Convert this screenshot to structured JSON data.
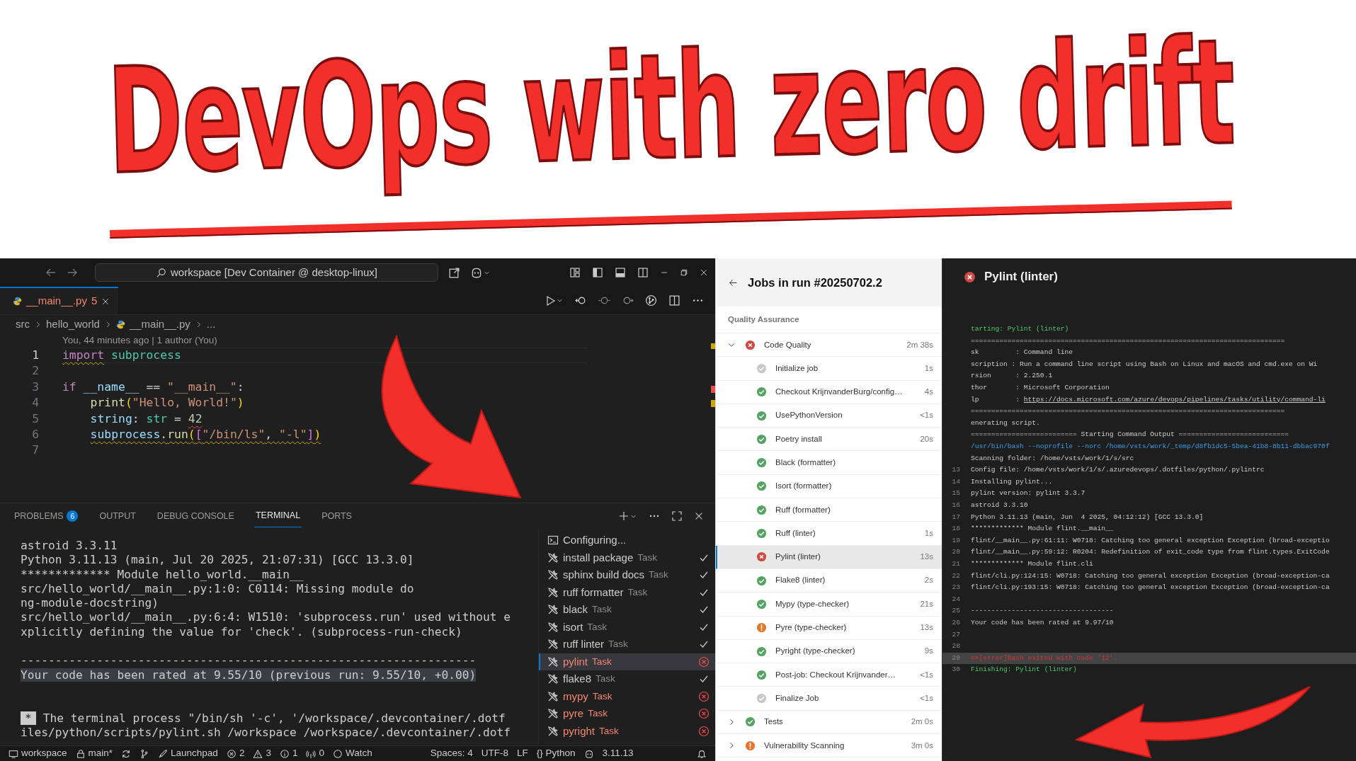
{
  "banner": {
    "title": "DevOps with zero drift"
  },
  "editor_window": {
    "search": "workspace [Dev Container @ desktop-linux]",
    "tabs": [
      {
        "label": "__main__.py",
        "badge": "5",
        "selected": true
      }
    ],
    "breadcrumb": [
      "src",
      "hello_world",
      "__main__.py",
      "..."
    ],
    "blame": "You, 44 minutes ago | 1 author (You)",
    "code_lines": [
      {
        "number": "1",
        "current": true,
        "tokens": [
          {
            "text": "import",
            "kind": "keyword",
            "warning": true
          },
          {
            "text": " subprocess",
            "kind": "module"
          }
        ]
      },
      {
        "number": "2",
        "current": false
      },
      {
        "number": "3",
        "current": false,
        "tokens": [
          {
            "text": "if ",
            "kind": "keyword"
          },
          {
            "text": "__name__",
            "kind": "var"
          },
          {
            "text": " == ",
            "kind": "plain"
          },
          {
            "text": "\"__main__\"",
            "kind": "string"
          },
          {
            "text": ":",
            "kind": "plain"
          }
        ]
      },
      {
        "number": "4",
        "current": false,
        "indented": true,
        "tokens": [
          {
            "text": "print",
            "kind": "func"
          },
          {
            "text": "(",
            "kind": "bracket1"
          },
          {
            "text": "\"Hello, World!\"",
            "kind": "string"
          },
          {
            "text": ")",
            "kind": "bracket1"
          }
        ]
      },
      {
        "number": "5",
        "current": false,
        "indented": true,
        "tokens": [
          {
            "text": "string",
            "kind": "var"
          },
          {
            "text": ": ",
            "kind": "plain"
          },
          {
            "text": "str",
            "kind": "type"
          },
          {
            "text": " = ",
            "kind": "plain"
          },
          {
            "text": "42",
            "kind": "number",
            "error": true
          }
        ]
      },
      {
        "number": "6",
        "current": false,
        "indented": true,
        "tokens": [
          {
            "text": "subprocess",
            "kind": "var",
            "warning": true
          },
          {
            "text": ".",
            "kind": "plain",
            "warning": true
          },
          {
            "text": "run",
            "kind": "func",
            "warning": true
          },
          {
            "text": "(",
            "kind": "bracket1",
            "warning": true
          },
          {
            "text": "[",
            "kind": "bracket2",
            "warning": true
          },
          {
            "text": "\"/bin/ls\"",
            "kind": "string",
            "warning": true
          },
          {
            "text": ", ",
            "kind": "plain",
            "warning": true
          },
          {
            "text": "\"-l\"",
            "kind": "string",
            "warning": true
          },
          {
            "text": "]",
            "kind": "bracket2",
            "warning": true
          },
          {
            "text": ")",
            "kind": "bracket1",
            "warning": true
          }
        ]
      },
      {
        "number": "7",
        "current": false
      }
    ],
    "panel_tabs": [
      {
        "label": "PROBLEMS",
        "count": "6",
        "selected": false
      },
      {
        "label": "OUTPUT",
        "selected": false
      },
      {
        "label": "DEBUG CONSOLE",
        "selected": false
      },
      {
        "label": "TERMINAL",
        "selected": true
      },
      {
        "label": "PORTS",
        "selected": false
      }
    ],
    "terminal_lines": [
      {
        "kind": "text",
        "text": "astroid 3.3.11"
      },
      {
        "kind": "text",
        "text": "Python 3.11.13 (main, Jul 20 2025, 21:07:31) [GCC 13.3.0]"
      },
      {
        "kind": "text",
        "text": "************* Module hello_world.__main__"
      },
      {
        "kind": "text",
        "text": "src/hello_world/__main__.py:1:0: C0114: Missing module do"
      },
      {
        "kind": "text",
        "text": "ng-module-docstring)"
      },
      {
        "kind": "text",
        "text": "src/hello_world/__main__.py:6:4: W1510: 'subprocess.run' used without e"
      },
      {
        "kind": "text",
        "text": "xplicitly defining the value for 'check'. (subprocess-run-check)"
      },
      {
        "kind": "blank"
      },
      {
        "kind": "text",
        "text": "------------------------------------------------------------------"
      },
      {
        "kind": "highlight",
        "text": "Your code has been rated at 9.55/10 (previous run: 9.55/10, +0.00)"
      },
      {
        "kind": "blank"
      },
      {
        "kind": "blank"
      },
      {
        "kind": "badge",
        "badge": "*",
        "text": "The terminal process \"/bin/sh '-c', '/workspace/.devcontainer/.dotf"
      },
      {
        "kind": "text",
        "text": "iles/python/scripts/pylint.sh /workspace /workspace/.devcontainer/.dotf"
      }
    ],
    "tasks": [
      {
        "kind": "terminal",
        "label": "Configuring...",
        "passed": false,
        "failed": false,
        "selected": false
      },
      {
        "kind": "task",
        "label": "install package",
        "suffix": "Task",
        "passed": true,
        "failed": false,
        "selected": false
      },
      {
        "kind": "task",
        "label": "sphinx build docs",
        "suffix": "Task",
        "passed": true,
        "failed": false,
        "selected": false
      },
      {
        "kind": "task",
        "label": "ruff formatter",
        "suffix": "Task",
        "passed": true,
        "failed": false,
        "selected": false
      },
      {
        "kind": "task",
        "label": "black",
        "suffix": "Task",
        "passed": true,
        "failed": false,
        "selected": false
      },
      {
        "kind": "task",
        "label": "isort",
        "suffix": "Task",
        "passed": true,
        "failed": false,
        "selected": false
      },
      {
        "kind": "task",
        "label": "ruff linter",
        "suffix": "Task",
        "passed": true,
        "failed": false,
        "selected": false
      },
      {
        "kind": "task",
        "label": "pylint",
        "suffix": "Task",
        "passed": false,
        "failed": true,
        "selected": true
      },
      {
        "kind": "task",
        "label": "flake8",
        "suffix": "Task",
        "passed": true,
        "failed": false,
        "selected": false
      },
      {
        "kind": "task",
        "label": "mypy",
        "suffix": "Task",
        "passed": false,
        "failed": true,
        "selected": false
      },
      {
        "kind": "task",
        "label": "pyre",
        "suffix": "Task",
        "passed": false,
        "failed": true,
        "selected": false
      },
      {
        "kind": "task",
        "label": "pyright",
        "suffix": "Task",
        "passed": false,
        "failed": true,
        "selected": false
      }
    ],
    "status_bar": [
      {
        "kind": "remote",
        "text": "workspace"
      },
      {
        "kind": "branch",
        "text": "main*"
      },
      {
        "kind": "sync"
      },
      {
        "kind": "graph"
      },
      {
        "kind": "launchpad",
        "text": "Launchpad"
      },
      {
        "kind": "errors",
        "text": "2"
      },
      {
        "kind": "warnings",
        "text": "3"
      },
      {
        "kind": "infos",
        "text": "1"
      },
      {
        "kind": "ports",
        "text": "0"
      },
      {
        "kind": "watch",
        "text": "Watch"
      },
      {
        "kind": "plain",
        "text": "Spaces: 4"
      },
      {
        "kind": "plain",
        "text": "UTF-8"
      },
      {
        "kind": "plain",
        "text": "LF"
      },
      {
        "kind": "plain",
        "text": "{} Python"
      },
      {
        "kind": "copilot"
      },
      {
        "kind": "plain",
        "text": "3.11.13"
      },
      {
        "kind": "bell"
      }
    ]
  },
  "jobs_panel": {
    "title": "Jobs in run #20250702.2",
    "section": "Quality Assurance",
    "jobs": [
      {
        "name": "Code Quality",
        "kind": "failed",
        "duration": "2m 38s",
        "expanded": true,
        "steps": [
          {
            "name": "Initialize job",
            "kind": "skipped",
            "duration": "1s",
            "selected": false
          },
          {
            "name": "Checkout KrijnvanderBurg/config…",
            "kind": "succeeded",
            "duration": "4s",
            "selected": false
          },
          {
            "name": "UsePythonVersion",
            "kind": "succeeded",
            "duration": "<1s",
            "selected": false
          },
          {
            "name": "Poetry install",
            "kind": "succeeded",
            "duration": "20s",
            "selected": false
          },
          {
            "name": "Black (formatter)",
            "kind": "succeeded",
            "selected": false
          },
          {
            "name": "Isort (formatter)",
            "kind": "succeeded",
            "selected": false
          },
          {
            "name": "Ruff (formatter)",
            "kind": "succeeded",
            "selected": false
          },
          {
            "name": "Ruff (linter)",
            "kind": "succeeded",
            "duration": "1s",
            "selected": false
          },
          {
            "name": "Pylint (linter)",
            "kind": "failed",
            "duration": "13s",
            "selected": true
          },
          {
            "name": "Flake8 (linter)",
            "kind": "succeeded",
            "duration": "2s",
            "selected": false
          },
          {
            "name": "Mypy (type-checker)",
            "kind": "succeeded",
            "duration": "21s",
            "selected": false
          },
          {
            "name": "Pyre (type-checker)",
            "kind": "warning",
            "duration": "13s",
            "selected": false
          },
          {
            "name": "Pyright (type-checker)",
            "kind": "succeeded",
            "duration": "9s",
            "selected": false
          },
          {
            "name": "Post-job: Checkout Krijnvander…",
            "kind": "succeeded",
            "duration": "<1s",
            "selected": false
          },
          {
            "name": "Finalize Job",
            "kind": "skipped",
            "duration": "<1s",
            "selected": false
          }
        ]
      },
      {
        "name": "Tests",
        "kind": "succeeded",
        "duration": "2m 0s",
        "expanded": false
      },
      {
        "name": "Vulnerability Scanning",
        "kind": "warning",
        "duration": "3m 0s",
        "expanded": false
      }
    ]
  },
  "log_panel": {
    "title": "Pylint (linter)",
    "failed": true,
    "lines": [
      {
        "kind": "green",
        "text": "tarting: Pylint (linter)"
      },
      {
        "kind": "normal",
        "text": "============================================================================="
      },
      {
        "kind": "normal",
        "text": "sk         : Command line"
      },
      {
        "kind": "normal",
        "text": "scription : Run a command line script using Bash on Linux and macOS and cmd.exe on Wi"
      },
      {
        "kind": "normal",
        "text": "rsion      : 2.250.1"
      },
      {
        "kind": "normal",
        "text": "thor       : Microsoft Corporation"
      },
      {
        "kind": "link",
        "text": "lp         : ",
        "link": "https://docs.microsoft.com/azure/devops/pipelines/tasks/utility/command-li"
      },
      {
        "kind": "normal",
        "text": "============================================================================="
      },
      {
        "kind": "normal",
        "text": "enerating script."
      },
      {
        "kind": "normal",
        "text": "========================== Starting Command Output ==========================="
      },
      {
        "kind": "blue",
        "text": "/usr/bin/bash --noprofile --norc /home/vsts/work/_temp/d8fb1dc5-5bea-41b8-8b11-dbbac970f"
      },
      {
        "kind": "normal",
        "text": "Scanning folder: /home/vsts/work/1/s/src"
      },
      {
        "kind": "normal",
        "number": "13",
        "text": "Config file: /home/vsts/work/1/s/.azuredevops/.dotfiles/python/.pylintrc"
      },
      {
        "kind": "normal",
        "number": "14",
        "text": "Installing pylint..."
      },
      {
        "kind": "normal",
        "number": "15",
        "text": "pylint version: pylint 3.3.7"
      },
      {
        "kind": "normal",
        "number": "16",
        "text": "astroid 3.3.10"
      },
      {
        "kind": "normal",
        "number": "17",
        "text": "Python 3.11.13 (main, Jun  4 2025, 04:12:12) [GCC 13.3.0]"
      },
      {
        "kind": "normal",
        "number": "18",
        "text": "************* Module flint.__main__"
      },
      {
        "kind": "normal",
        "number": "19",
        "text": "flint/__main__.py:61:11: W0718: Catching too general exception Exception (broad-exceptio"
      },
      {
        "kind": "normal",
        "number": "20",
        "text": "flint/__main__.py:59:12: R0204: Redefinition of exit_code type from flint.types.ExitCode"
      },
      {
        "kind": "normal",
        "number": "21",
        "text": "************* Module flint.cli"
      },
      {
        "kind": "normal",
        "number": "22",
        "text": "flint/cli.py:124:15: W0718: Catching too general exception Exception (broad-exception-ca"
      },
      {
        "kind": "normal",
        "number": "23",
        "text": "flint/cli.py:193:15: W0718: Catching too general exception Exception (broad-exception-ca"
      },
      {
        "kind": "blank",
        "number": "24"
      },
      {
        "kind": "normal",
        "number": "25",
        "text": "-----------------------------------"
      },
      {
        "kind": "normal",
        "number": "26",
        "text": "Your code has been rated at 9.97/10"
      },
      {
        "kind": "blank",
        "number": "27"
      },
      {
        "kind": "blank",
        "number": "28"
      },
      {
        "kind": "error",
        "number": "29",
        "text": "##[error]Bash exited with code '12'.",
        "highlighted": true
      },
      {
        "kind": "green",
        "number": "30",
        "text": "Finishing: Pylint (linter)"
      }
    ]
  }
}
